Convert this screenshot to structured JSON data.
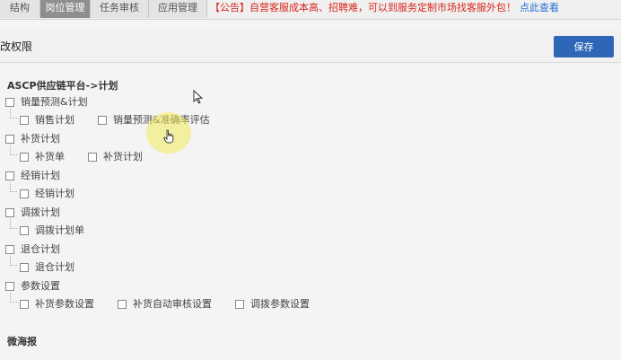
{
  "topbar": {
    "tabs": [
      {
        "label": "结构",
        "active": false
      },
      {
        "label": "岗位管理",
        "active": true
      },
      {
        "label": "任务审核",
        "active": false
      },
      {
        "label": "应用管理",
        "active": false
      }
    ],
    "notice_text": "【公告】自营客服成本高、招聘难，可以到服务定制市场找客服外包！",
    "notice_link": "点此查看"
  },
  "header": {
    "title": "改权限",
    "save_label": "保存"
  },
  "platform": {
    "title": "ASCP供应链平台->计划",
    "groups": [
      {
        "label": "销量预测&计划",
        "children": [
          "销售计划",
          "销量预测&准确率评估"
        ]
      },
      {
        "label": "补货计划",
        "children": [
          "补货单",
          "补货计划"
        ]
      },
      {
        "label": "经销计划",
        "children": [
          "经销计划"
        ]
      },
      {
        "label": "调拨计划",
        "children": [
          "调拨计划单"
        ]
      },
      {
        "label": "退仓计划",
        "children": [
          "退仓计划"
        ]
      },
      {
        "label": "参数设置",
        "children": [
          "补货参数设置",
          "补货自动审核设置",
          "调拨参数设置"
        ]
      }
    ]
  },
  "next_section": {
    "title": "微海报"
  },
  "colors": {
    "save_button": "#2f67b8",
    "notice_red": "#d9261c",
    "link_blue": "#2b6fd4",
    "active_tab": "#8e8e8e"
  }
}
